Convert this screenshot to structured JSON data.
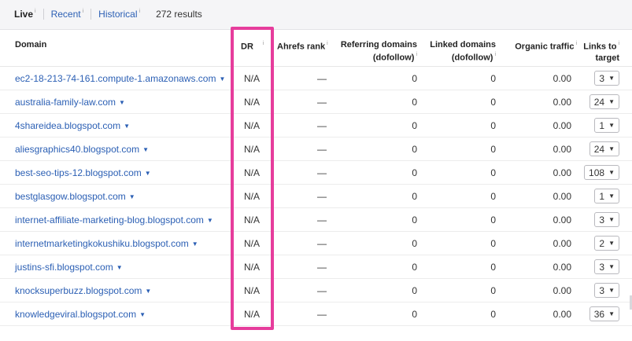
{
  "tabs": {
    "live": "Live",
    "recent": "Recent",
    "historical": "Historical",
    "info": "i"
  },
  "results_count": "272 results",
  "columns": {
    "domain": "Domain",
    "dr": "DR",
    "ahrefs_rank": "Ahrefs rank",
    "referring_line1": "Referring domains",
    "referring_line2": "(dofollow)",
    "linked_line1": "Linked domains",
    "linked_line2": "(dofollow)",
    "organic": "Organic traffic",
    "links_line1": "Links to",
    "links_line2": "target",
    "info": "i"
  },
  "rows": [
    {
      "domain": "ec2-18-213-74-161.compute-1.amazonaws.com",
      "dr": "N/A",
      "rank": "—",
      "ref": "0",
      "linked": "0",
      "traffic": "0.00",
      "links": "3"
    },
    {
      "domain": "australia-family-law.com",
      "dr": "N/A",
      "rank": "—",
      "ref": "0",
      "linked": "0",
      "traffic": "0.00",
      "links": "24"
    },
    {
      "domain": "4shareidea.blogspot.com",
      "dr": "N/A",
      "rank": "—",
      "ref": "0",
      "linked": "0",
      "traffic": "0.00",
      "links": "1"
    },
    {
      "domain": "aliesgraphics40.blogspot.com",
      "dr": "N/A",
      "rank": "—",
      "ref": "0",
      "linked": "0",
      "traffic": "0.00",
      "links": "24"
    },
    {
      "domain": "best-seo-tips-12.blogspot.com",
      "dr": "N/A",
      "rank": "—",
      "ref": "0",
      "linked": "0",
      "traffic": "0.00",
      "links": "108"
    },
    {
      "domain": "bestglasgow.blogspot.com",
      "dr": "N/A",
      "rank": "—",
      "ref": "0",
      "linked": "0",
      "traffic": "0.00",
      "links": "1"
    },
    {
      "domain": "internet-affiliate-marketing-blog.blogspot.com",
      "dr": "N/A",
      "rank": "—",
      "ref": "0",
      "linked": "0",
      "traffic": "0.00",
      "links": "3"
    },
    {
      "domain": "internetmarketingkokushiku.blogspot.com",
      "dr": "N/A",
      "rank": "—",
      "ref": "0",
      "linked": "0",
      "traffic": "0.00",
      "links": "2"
    },
    {
      "domain": "justins-sfi.blogspot.com",
      "dr": "N/A",
      "rank": "—",
      "ref": "0",
      "linked": "0",
      "traffic": "0.00",
      "links": "3"
    },
    {
      "domain": "knocksuperbuzz.blogspot.com",
      "dr": "N/A",
      "rank": "—",
      "ref": "0",
      "linked": "0",
      "traffic": "0.00",
      "links": "3"
    },
    {
      "domain": "knowledgeviral.blogspot.com",
      "dr": "N/A",
      "rank": "—",
      "ref": "0",
      "linked": "0",
      "traffic": "0.00",
      "links": "36"
    }
  ],
  "colors": {
    "link": "#2b5fb4",
    "highlight": "#e63d9c"
  },
  "icons": {
    "dropdown": "caret-down-icon"
  }
}
